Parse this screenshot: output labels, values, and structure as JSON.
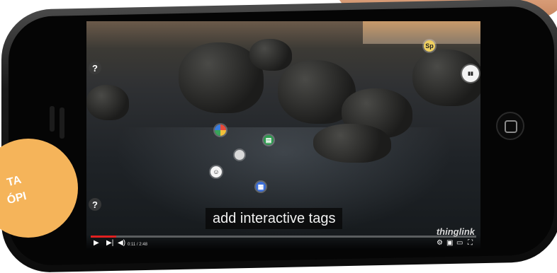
{
  "video": {
    "caption": "add interactive tags",
    "watermark": "thinglink",
    "time_display": "0:11 / 2:48",
    "progress_fraction": 0.066
  },
  "tags": {
    "help_top": "?",
    "help_bottom": "?",
    "tag_sp": "Sp",
    "tag_book": "▮▮"
  },
  "badge": {
    "line1": "TA",
    "line2": "ÓPI"
  },
  "colors": {
    "progress": "#e02020",
    "badge": "#f5b45a"
  }
}
